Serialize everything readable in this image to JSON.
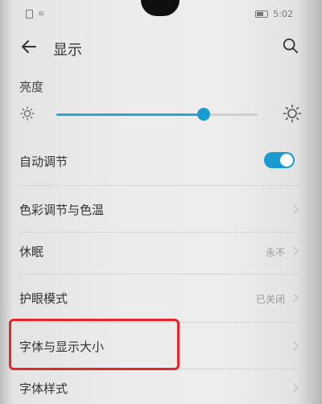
{
  "status_bar": {
    "time": "5:02"
  },
  "header": {
    "title": "显示",
    "back_icon": "arrow-left-icon",
    "search_icon": "search-icon"
  },
  "brightness": {
    "label": "亮度",
    "level": 0.73,
    "min_icon": "sun-small-icon",
    "max_icon": "sun-large-icon"
  },
  "settings": {
    "auto_adjust": {
      "label": "自动调节",
      "enabled": true
    },
    "color_temp": {
      "label": "色彩调节与色温"
    },
    "sleep": {
      "label": "休眠",
      "value": "永不"
    },
    "eye_comfort": {
      "label": "护眼模式",
      "value": "已关闭"
    },
    "font_display_size": {
      "label": "字体与显示大小"
    },
    "font_style": {
      "label": "字体样式"
    }
  },
  "colors": {
    "accent": "#1a9bd0",
    "highlight": "#e5242b"
  }
}
